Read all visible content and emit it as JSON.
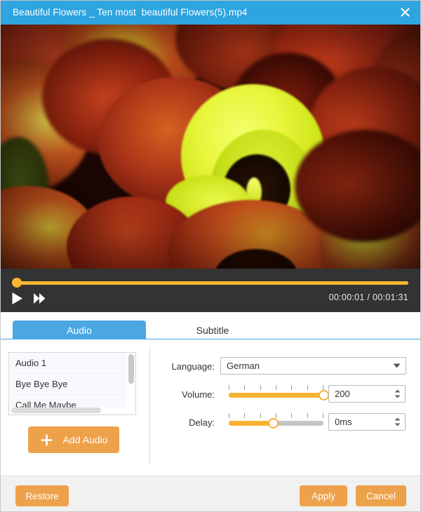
{
  "window": {
    "title": "Beautiful Flowers _ Ten most  beautiful Flowers(5).mp4",
    "close_icon": "close-icon",
    "titlebar_color": "#2ea4e0"
  },
  "player": {
    "play_icon": "play-icon",
    "fast_forward_icon": "fast-forward-icon",
    "current_time": "00:00:01",
    "separator": "/",
    "total_time": "00:01:31",
    "time_display": "00:00:01 / 00:01:31",
    "progress_percent": 0,
    "accent_color": "#fbb731",
    "bar_color": "#333333"
  },
  "tabs": [
    {
      "label": "Audio",
      "active": true
    },
    {
      "label": "Subtitle",
      "active": false
    }
  ],
  "tracks": {
    "items": [
      {
        "label": "Audio 1"
      },
      {
        "label": "Bye Bye Bye"
      },
      {
        "label": "Call Me Maybe"
      }
    ],
    "vertical_scrollbar": "vertical-scrollbar",
    "horizontal_scrollbar": "horizontal-scrollbar"
  },
  "add_audio": {
    "label": "Add Audio",
    "icon": "plus-icon",
    "color": "#eda14a"
  },
  "settings": {
    "language": {
      "label": "Language:",
      "value": "German",
      "caret_icon": "chevron-down-icon"
    },
    "volume": {
      "label": "Volume:",
      "value": "200",
      "slider_percent": 100,
      "tick_count": 7,
      "stepper_icon": "stepper-arrows-icon"
    },
    "delay": {
      "label": "Delay:",
      "value": "0ms",
      "slider_percent": 47,
      "tick_count": 7,
      "stepper_icon": "stepper-arrows-icon"
    }
  },
  "footer": {
    "restore_label": "Restore",
    "apply_label": "Apply",
    "cancel_label": "Cancel",
    "button_color": "#eda14a"
  }
}
